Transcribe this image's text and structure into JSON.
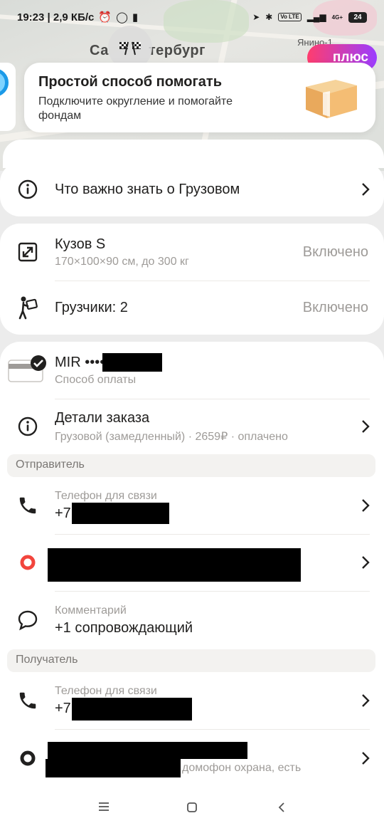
{
  "status_bar": {
    "time_speed": "19:23 | 2,9 КБ/с",
    "battery": "24",
    "network": "4G+",
    "volte": "Vo LTE"
  },
  "map": {
    "city_part1": "Са",
    "city_part2": "тербург",
    "district": "Янино-1",
    "plus_label": "плюс"
  },
  "promo": {
    "title": "Простой способ помогать",
    "text": "Подключите округление и помогайте фондам"
  },
  "info": {
    "label": "Что важно знать о Грузовом"
  },
  "options": {
    "body_title": "Кузов S",
    "body_sub": "170×100×90 см, до 300 кг",
    "body_value": "Включено",
    "loaders_title": "Грузчики: 2",
    "loaders_value": "Включено"
  },
  "payment": {
    "card_label": "MIR ••••",
    "card_sub": "Способ оплаты",
    "details_title": "Детали заказа",
    "details_sub": "Грузовой (замедленный) · 2659₽ · оплачено"
  },
  "sender": {
    "section": "Отправитель",
    "phone_caption": "Телефон для связи",
    "phone_prefix": "+7",
    "comment_caption": "Комментарий",
    "comment_value": "+1 сопровождающий"
  },
  "receiver": {
    "section": "Получатель",
    "phone_caption": "Телефон для связи",
    "phone_prefix": "+7",
    "address_tail": "домофон охрана, есть"
  },
  "colors": {
    "accent_red": "#f2453d",
    "text_primary": "#21201f",
    "text_secondary": "#9e9b98"
  }
}
